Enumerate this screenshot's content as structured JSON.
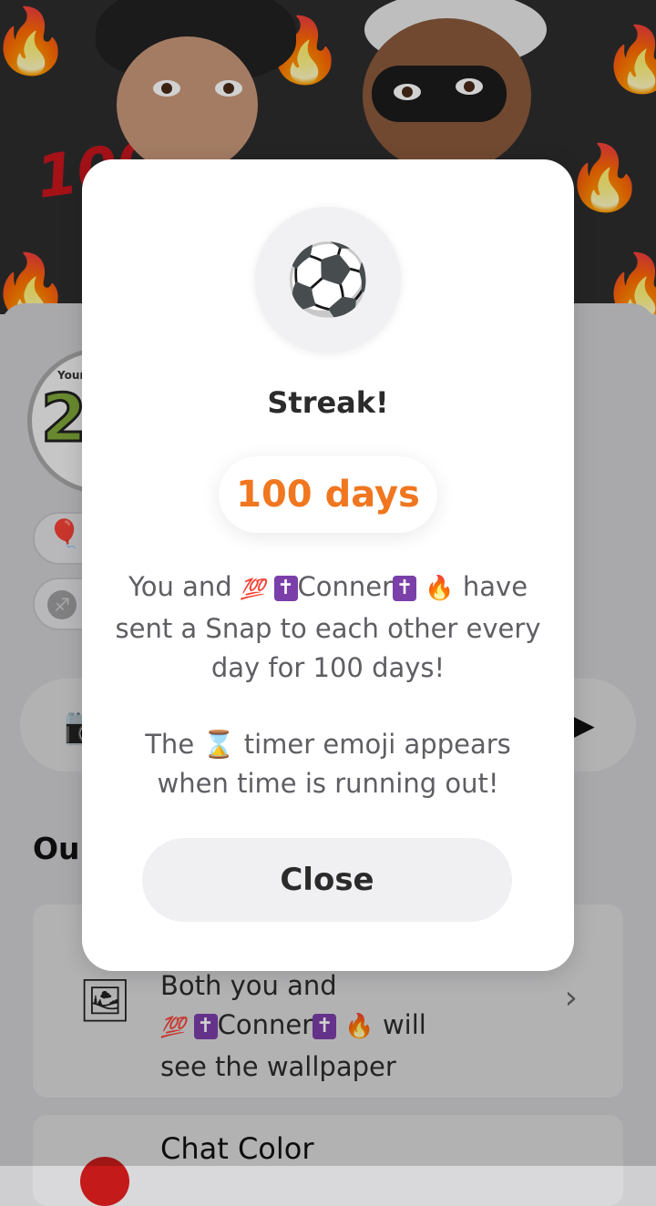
{
  "modal": {
    "icon": "soccer-ball-icon",
    "title": "Streak!",
    "days": "100 days",
    "line1_prefix": "You and ",
    "line1_name": "Conner",
    "line1_suffix": " have",
    "line2": "sent a Snap to each other every",
    "line3": "day for 100 days!",
    "timer_line1_prefix": "The ",
    "timer_line1_suffix": " timer emoji appears",
    "timer_line2": "when time is running out!",
    "close_label": "Close"
  },
  "background": {
    "section_title": "Ou",
    "badge_number": "2",
    "badge_top_text": "Your I",
    "wallpaper_line1": "Both you and",
    "wallpaper_name": "Conner",
    "wallpaper_suffix": " will",
    "wallpaper_line3": "see the wallpaper",
    "chat_color_label": "Chat Color"
  },
  "colors": {
    "accent_orange": "#f0761f",
    "modal_bg": "#ffffff",
    "cross_purple": "#7a3fa8"
  }
}
